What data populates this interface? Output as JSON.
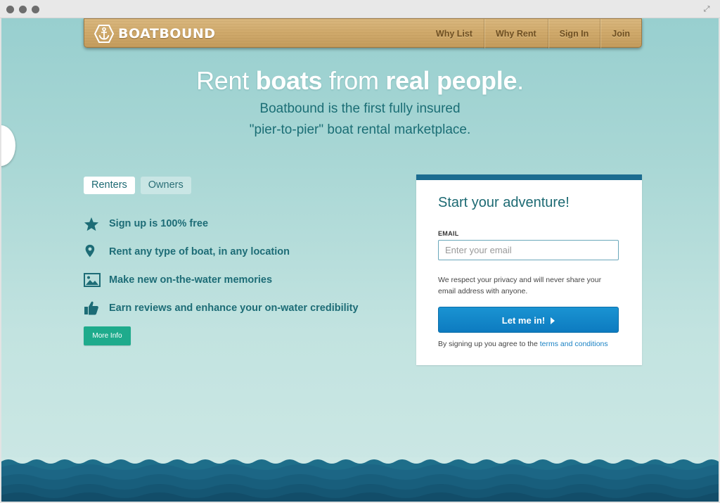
{
  "nav": {
    "logo_text": "BOATBOUND",
    "links": [
      "Why List",
      "Why Rent",
      "Sign In",
      "Join"
    ]
  },
  "hero": {
    "title_parts": [
      "Rent ",
      "boats",
      " from ",
      "real people",
      "."
    ],
    "subtitle_line1": "Boatbound is the first fully insured",
    "subtitle_line2": "\"pier-to-pier\" boat rental marketplace."
  },
  "tabs": {
    "renters": "Renters",
    "owners": "Owners",
    "active": "Renters"
  },
  "features": [
    {
      "icon": "star-icon",
      "text": "Sign up is 100% free"
    },
    {
      "icon": "location-pin-icon",
      "text": "Rent any type of boat, in any location"
    },
    {
      "icon": "picture-icon",
      "text": "Make new on-the-water memories"
    },
    {
      "icon": "thumbs-up-icon",
      "text": "Earn reviews and enhance your on-water credibility"
    }
  ],
  "more_info_label": "More Info",
  "signup": {
    "title": "Start your adventure!",
    "email_label": "EMAIL",
    "email_placeholder": "Enter your email",
    "email_value": "",
    "privacy_text": "We respect your privacy and will never share your email address with anyone.",
    "cta_label": "Let me in!",
    "terms_prefix": "By signing up you agree to the ",
    "terms_link": "terms and conditions"
  },
  "colors": {
    "accent_teal": "#1d6a73",
    "card_top_border": "#1b6c90",
    "cta_blue": "#1183c8",
    "more_info_green": "#1eab8c"
  }
}
